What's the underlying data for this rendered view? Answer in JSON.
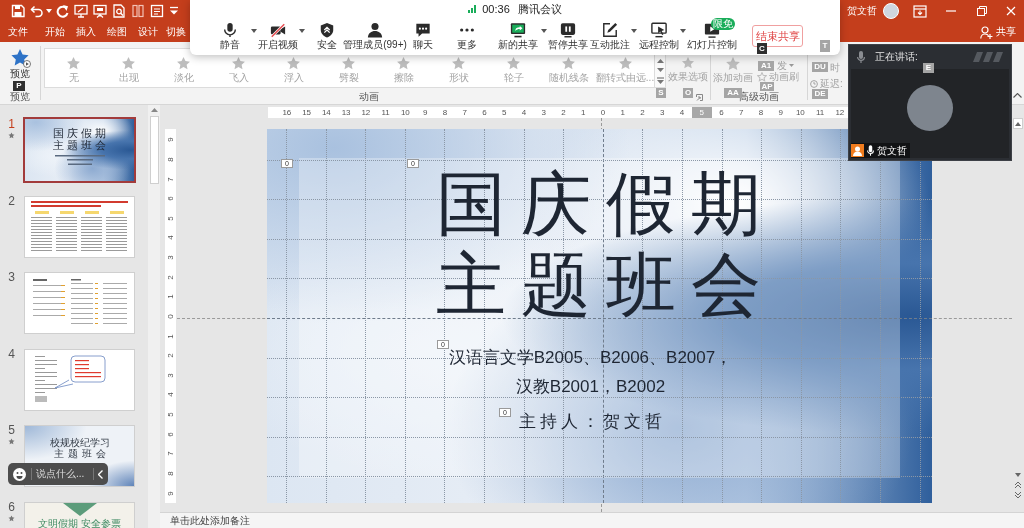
{
  "title_bar": {
    "user_name": "贺文哲"
  },
  "ribbon": {
    "tabs": [
      {
        "label": "文件",
        "selected": false
      },
      {
        "label": "开始",
        "selected": false
      },
      {
        "label": "插入",
        "selected": false
      },
      {
        "label": "绘图",
        "selected": false
      },
      {
        "label": "设计",
        "selected": false
      },
      {
        "label": "切换",
        "selected": false
      }
    ],
    "share_button": "共享",
    "preview": {
      "label": "预览",
      "group_label": "预览"
    },
    "animations": {
      "disabled": true,
      "effects": [
        "无",
        "出现",
        "淡化",
        "飞入",
        "浮入",
        "劈裂",
        "擦除",
        "形状",
        "轮子",
        "随机线条",
        "翻转式由远..."
      ],
      "effect_options": "效果选项",
      "group_label": "动画"
    },
    "advanced_animation": {
      "add_animation": "添加动画",
      "items": [
        "发",
        "动画刷"
      ],
      "group_label": "高级动画"
    },
    "timing": {
      "items": [
        "时",
        "延迟:"
      ]
    }
  },
  "keytips": [
    {
      "label": "C",
      "disabled": false
    },
    {
      "label": "T",
      "disabled": true
    },
    {
      "label": "A1",
      "disabled": true
    },
    {
      "label": "DU",
      "disabled": true
    },
    {
      "label": "E",
      "disabled": true
    },
    {
      "label": "P",
      "disabled": false
    },
    {
      "label": "AP",
      "disabled": true
    },
    {
      "label": "S",
      "disabled": true
    },
    {
      "label": "O",
      "disabled": true
    },
    {
      "label": "AA",
      "disabled": true
    },
    {
      "label": "DE",
      "disabled": true
    }
  ],
  "meeting_toolbar": {
    "timer": "00:36",
    "app_name": "腾讯会议",
    "tools": [
      {
        "label": "静音",
        "kind": "mic",
        "dropdown": true
      },
      {
        "label": "开启视频",
        "kind": "camera_off",
        "dropdown": true
      },
      {
        "label": "安全",
        "kind": "shield",
        "dropdown": false
      },
      {
        "label": "管理成员(99+)",
        "kind": "members",
        "dropdown": false
      },
      {
        "label": "聊天",
        "kind": "chat",
        "dropdown": false
      },
      {
        "label": "更多",
        "kind": "more",
        "dropdown": false
      },
      {
        "label": "新的共享",
        "kind": "share",
        "dropdown": true
      },
      {
        "label": "暂停共享",
        "kind": "pause",
        "dropdown": false
      },
      {
        "label": "互动批注",
        "kind": "annotate",
        "dropdown": true
      },
      {
        "label": "远程控制",
        "kind": "remote",
        "dropdown": true
      },
      {
        "label": "幻灯片控制",
        "kind": "slides",
        "dropdown": false,
        "badge": "限免"
      }
    ],
    "end_button": "结束共享"
  },
  "video_panel": {
    "header": "正在讲话:",
    "speaker_name": "贺文哲"
  },
  "slide_thumbnails": [
    {
      "number": "1",
      "selected": true,
      "animated": true,
      "kind": "title",
      "lines": [
        "国庆假期",
        "主题班会"
      ]
    },
    {
      "number": "2",
      "selected": false,
      "animated": false,
      "kind": "article"
    },
    {
      "number": "3",
      "selected": false,
      "animated": false,
      "kind": "table"
    },
    {
      "number": "4",
      "selected": false,
      "animated": false,
      "kind": "callout"
    },
    {
      "number": "5",
      "selected": false,
      "animated": true,
      "kind": "cover",
      "lines": [
        "校规校纪学习",
        "主题班会"
      ]
    },
    {
      "number": "6",
      "selected": false,
      "animated": true,
      "kind": "banner",
      "lines": [
        "文明假期 安全参票"
      ]
    }
  ],
  "chat_input": {
    "placeholder": "说点什么..."
  },
  "rulers": {
    "horizontal": [
      {
        "label": "16",
        "highlighted": false
      },
      {
        "label": "15",
        "highlighted": false
      },
      {
        "label": "14",
        "highlighted": false
      },
      {
        "label": "13",
        "highlighted": false
      },
      {
        "label": "12",
        "highlighted": false
      },
      {
        "label": "11",
        "highlighted": false
      },
      {
        "label": "10",
        "highlighted": false
      },
      {
        "label": "9",
        "highlighted": false
      },
      {
        "label": "8",
        "highlighted": false
      },
      {
        "label": "7",
        "highlighted": false
      },
      {
        "label": "6",
        "highlighted": false
      },
      {
        "label": "5",
        "highlighted": false
      },
      {
        "label": "4",
        "highlighted": false
      },
      {
        "label": "3",
        "highlighted": false
      },
      {
        "label": "2",
        "highlighted": false
      },
      {
        "label": "1",
        "highlighted": false
      },
      {
        "label": "0",
        "highlighted": false
      },
      {
        "label": "1",
        "highlighted": false
      },
      {
        "label": "2",
        "highlighted": false
      },
      {
        "label": "3",
        "highlighted": false
      },
      {
        "label": "4",
        "highlighted": false
      },
      {
        "label": "5",
        "highlighted": true
      },
      {
        "label": "6",
        "highlighted": false
      },
      {
        "label": "7",
        "highlighted": false
      },
      {
        "label": "8",
        "highlighted": false
      },
      {
        "label": "9",
        "highlighted": false
      },
      {
        "label": "10",
        "highlighted": false
      },
      {
        "label": "11",
        "highlighted": false
      },
      {
        "label": "12",
        "highlighted": false
      }
    ],
    "vertical": [
      "9",
      "8",
      "7",
      "6",
      "5",
      "4",
      "3",
      "2",
      "1",
      "0",
      "1",
      "2",
      "3",
      "4",
      "5",
      "6",
      "7",
      "8",
      "9"
    ]
  },
  "slide": {
    "title_lines": [
      "国庆假期",
      "主题班会"
    ],
    "subtitle_lines": [
      "汉语言文学B2005、B2006、B2007，",
      "汉教B2001，B2002"
    ],
    "host": "主持人：贺文哲",
    "animation_tags": [
      "0",
      "0",
      "0",
      "0"
    ]
  },
  "notes": {
    "placeholder": "单击此处添加备注"
  }
}
